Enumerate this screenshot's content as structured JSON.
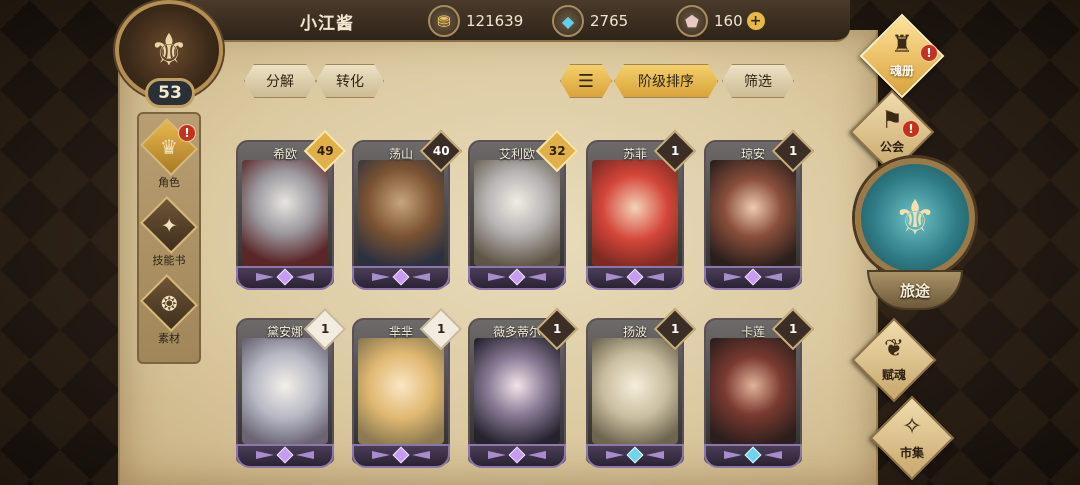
{
  "player": {
    "name": "小江酱",
    "level": "53"
  },
  "resources": [
    {
      "icon": "coin-icon",
      "value": "121639"
    },
    {
      "icon": "crystal-icon",
      "value": "2765"
    },
    {
      "icon": "gem-icon",
      "value": "160"
    }
  ],
  "sidebar": {
    "items": [
      {
        "label": "角色",
        "icon": "character-icon"
      },
      {
        "label": "技能书",
        "icon": "skillbook-icon"
      },
      {
        "label": "素材",
        "icon": "material-icon"
      }
    ]
  },
  "toolbar": {
    "decompose": "分解",
    "convert": "转化",
    "sort_by_tier": "阶级排序",
    "filter": "筛选"
  },
  "cards": [
    {
      "name": "希欧",
      "level": "49",
      "tier": "gold"
    },
    {
      "name": "荡山",
      "level": "40",
      "tier": "dark"
    },
    {
      "name": "艾利欧",
      "level": "32",
      "tier": "gold"
    },
    {
      "name": "苏菲",
      "level": "1",
      "tier": "dark"
    },
    {
      "name": "琼安",
      "level": "1",
      "tier": "dark"
    },
    {
      "name": "黛安娜",
      "level": "1",
      "tier": "light"
    },
    {
      "name": "芈芈",
      "level": "1",
      "tier": "light"
    },
    {
      "name": "薇多蒂尔",
      "level": "1",
      "tier": "dark"
    },
    {
      "name": "扬波",
      "level": "1",
      "tier": "dark"
    },
    {
      "name": "卡莲",
      "level": "1",
      "tier": "dark"
    }
  ],
  "right_menu": {
    "soul_book": "魂册",
    "guild": "公会",
    "journey": "旅途",
    "soul_endow": "赋魂",
    "market": "市集"
  },
  "colors": {
    "parchment": "#dccaa1",
    "gold": "#e0b04a",
    "alert": "#c2331f",
    "teal": "#2f7c86"
  }
}
